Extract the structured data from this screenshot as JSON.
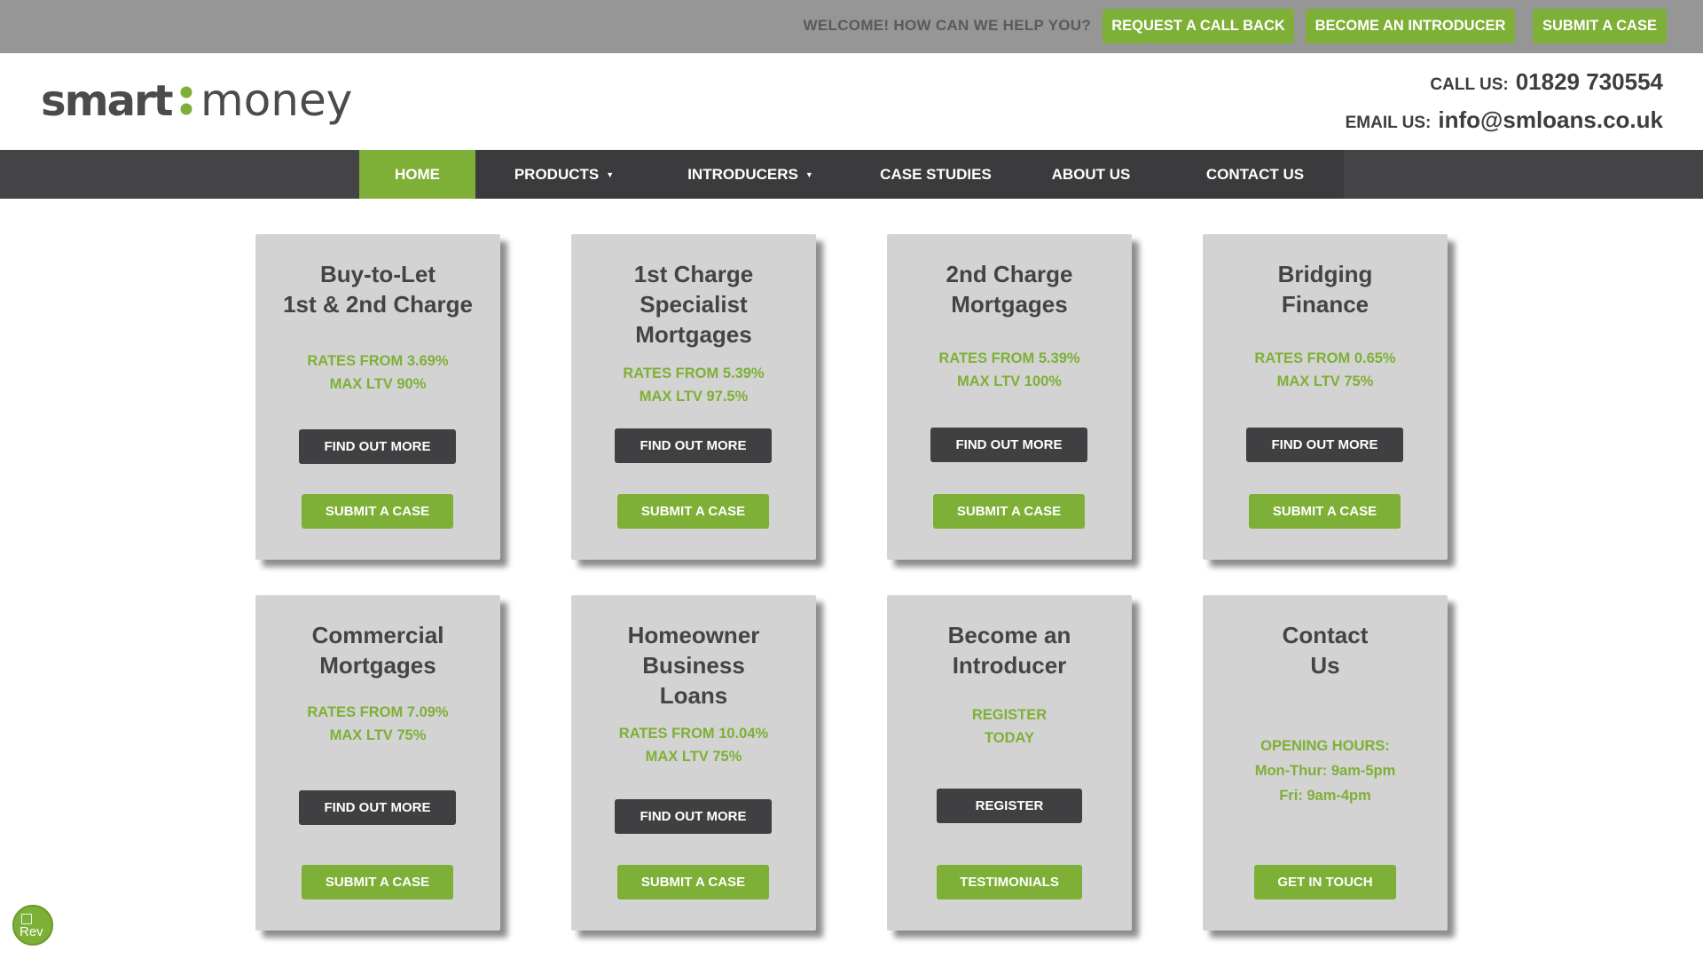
{
  "topbar": {
    "welcome": "WELCOME! HOW CAN WE HELP YOU?",
    "buttons": [
      "REQUEST A CALL BACK",
      "BECOME AN INTRODUCER",
      "SUBMIT A CASE"
    ]
  },
  "header": {
    "logo_word1": "smart",
    "logo_word2": "money",
    "call_label": "CALL US:",
    "call_value": "01829 730554",
    "email_label": "EMAIL US:",
    "email_value": "info@smloans.co.uk"
  },
  "nav": {
    "items": [
      "HOME",
      "PRODUCTS",
      "INTRODUCERS",
      "CASE STUDIES",
      "ABOUT US",
      "CONTACT US"
    ],
    "caret": "▼"
  },
  "cards": [
    {
      "title": [
        "Buy-to-Let",
        "1st & 2nd Charge"
      ],
      "green": [
        "RATES FROM 3.69%",
        "MAX LTV 90%"
      ],
      "dark": "FIND OUT MORE",
      "light": "SUBMIT A CASE"
    },
    {
      "title": [
        "1st Charge",
        "Specialist",
        "Mortgages"
      ],
      "green": [
        "RATES FROM 5.39%",
        "MAX LTV 97.5%"
      ],
      "dark": "FIND OUT MORE",
      "light": "SUBMIT A CASE"
    },
    {
      "title": [
        "2nd Charge",
        "Mortgages"
      ],
      "green": [
        "RATES FROM 5.39%",
        "MAX LTV 100%"
      ],
      "dark": "FIND OUT MORE",
      "light": "SUBMIT A CASE"
    },
    {
      "title": [
        "Bridging",
        "Finance"
      ],
      "green": [
        "RATES FROM 0.65%",
        "MAX LTV 75%"
      ],
      "dark": "FIND OUT MORE",
      "light": "SUBMIT A CASE"
    },
    {
      "title": [
        "Commercial",
        "Mortgages"
      ],
      "green": [
        "RATES FROM 7.09%",
        "MAX LTV 75%"
      ],
      "dark": "FIND OUT MORE",
      "light": "SUBMIT A CASE"
    },
    {
      "title": [
        "Homeowner",
        "Business",
        "Loans"
      ],
      "green": [
        "RATES FROM 10.04%",
        "MAX LTV 75%"
      ],
      "dark": "FIND OUT MORE",
      "light": "SUBMIT A CASE"
    },
    {
      "title": [
        "Become an",
        "Introducer"
      ],
      "green": [
        "REGISTER",
        "TODAY"
      ],
      "dark": "REGISTER",
      "light": "TESTIMONIALS"
    },
    {
      "title": [
        "Contact",
        "Us"
      ],
      "green": [
        "OPENING HOURS:",
        "Mon-Thur: 9am-5pm",
        "Fri: 9am-4pm"
      ],
      "light": "GET IN TOUCH"
    }
  ],
  "review_badge": {
    "alt_text": "Rev"
  },
  "colors": {
    "brand_green": "#7eb037",
    "dark_button": "#404042",
    "nav_bg": "#3b3b3d",
    "topbar_bg": "#969696",
    "card_bg": "#d3d3d3"
  }
}
